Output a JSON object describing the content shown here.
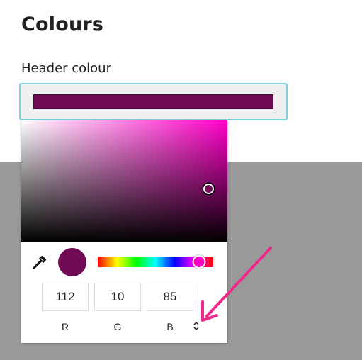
{
  "page": {
    "title": "Colours",
    "header_colour_label": "Header colour"
  },
  "colors": {
    "selected": "#700a55",
    "hue": "#ff00c8",
    "annotation_arrow": "#f0288c",
    "overlay_grey": "#999999",
    "field_border": "#7fd0d8"
  },
  "picker": {
    "hue_fraction": 0.88,
    "saturation_fraction": 0.91,
    "value_fraction": 0.44,
    "eyedropper_icon": "eyedropper-icon",
    "mode_toggle_icon": "up-down-chevron-icon",
    "channels": [
      {
        "value": "112",
        "label": "R"
      },
      {
        "value": "10",
        "label": "G"
      },
      {
        "value": "85",
        "label": "B"
      }
    ]
  }
}
